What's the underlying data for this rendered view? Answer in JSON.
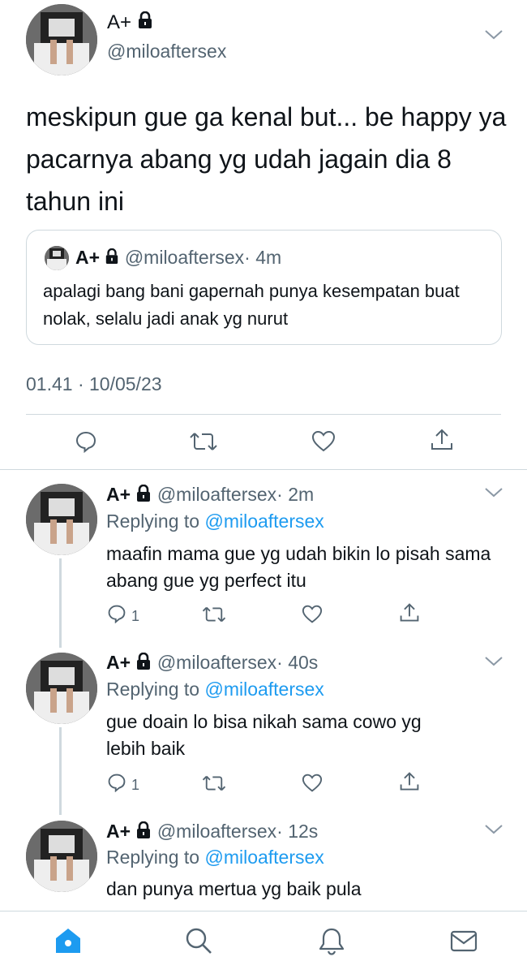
{
  "main_tweet": {
    "name": "A+",
    "handle": "@miloaftersex",
    "text": "meskipun gue ga kenal but... be happy ya pacarnya abang yg udah jagain dia 8 tahun ini",
    "quote": {
      "name": "A+",
      "handle": "@miloaftersex",
      "time": "· 4m",
      "text": "apalagi bang bani gapernah punya kesempatan buat nolak, selalu jadi anak yg nurut"
    },
    "timestamp": "01.41 · 10/05/23"
  },
  "replies": [
    {
      "name": "A+",
      "handle": "@miloaftersex",
      "time": "· 2m",
      "replying_prefix": "Replying to ",
      "replying_to": "@miloaftersex",
      "text": "maafin mama gue yg udah bikin lo pisah sama abang gue yg perfect itu",
      "reply_count": "1"
    },
    {
      "name": "A+",
      "handle": "@miloaftersex",
      "time": "· 40s",
      "replying_prefix": "Replying to ",
      "replying_to": "@miloaftersex",
      "text": "gue doain lo bisa nikah sama cowo yg lebih baik",
      "reply_count": "1"
    },
    {
      "name": "A+",
      "handle": "@miloaftersex",
      "time": "· 12s",
      "replying_prefix": "Replying to ",
      "replying_to": "@miloaftersex",
      "text": "dan punya mertua yg baik pula"
    }
  ],
  "icons": {
    "lock": "lock-icon",
    "chevron": "chevron-down-icon",
    "reply": "reply-icon",
    "retweet": "retweet-icon",
    "like": "heart-icon",
    "share": "share-icon",
    "home": "home-icon",
    "search": "search-icon",
    "notifications": "bell-icon",
    "messages": "mail-icon"
  },
  "colors": {
    "accent": "#1d9bf0",
    "secondary_text": "#536471",
    "divider": "#cfd9de"
  }
}
